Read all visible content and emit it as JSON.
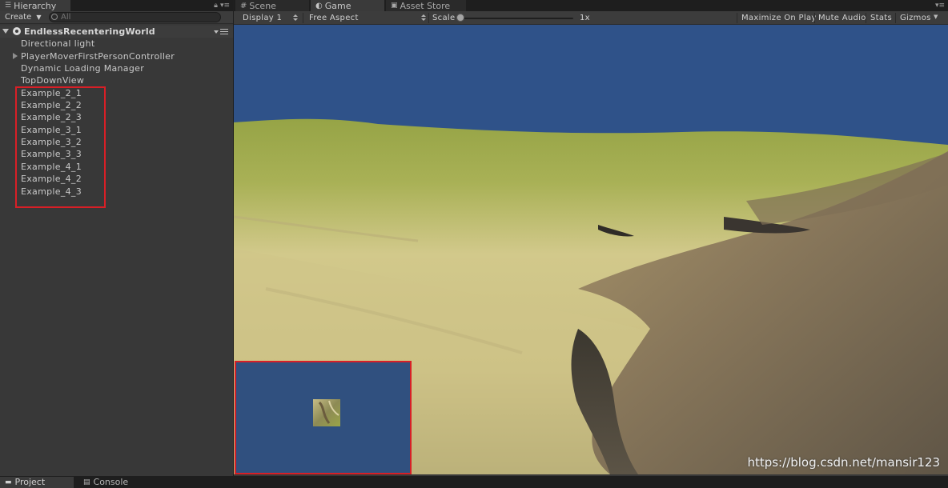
{
  "hierarchy": {
    "tab_label": "Hierarchy",
    "create_label": "Create",
    "search_placeholder": "All",
    "scene_name": "EndlessRecenteringWorld",
    "items": [
      "Directional light",
      "PlayerMoverFirstPersonController",
      "Dynamic Loading Manager",
      "TopDownView",
      "Example_2_1",
      "Example_2_2",
      "Example_2_3",
      "Example_3_1",
      "Example_3_2",
      "Example_3_3",
      "Example_4_1",
      "Example_4_2",
      "Example_4_3"
    ]
  },
  "game": {
    "tabs": [
      "Scene",
      "Game",
      "Asset Store"
    ],
    "active_tab": "Game",
    "display": "Display 1",
    "aspect": "Free Aspect",
    "scale_label": "Scale",
    "scale_value": "1x",
    "maximize_on_play": "Maximize On Play",
    "mute_audio": "Mute Audio",
    "stats": "Stats",
    "gizmos": "Gizmos",
    "sky_color": "#2f5289",
    "minimap_bg": "#30507f",
    "highlight_color": "#d81f26"
  },
  "bottom_tabs": [
    "Project",
    "Console"
  ],
  "watermark": "https://blog.csdn.net/mansir123"
}
